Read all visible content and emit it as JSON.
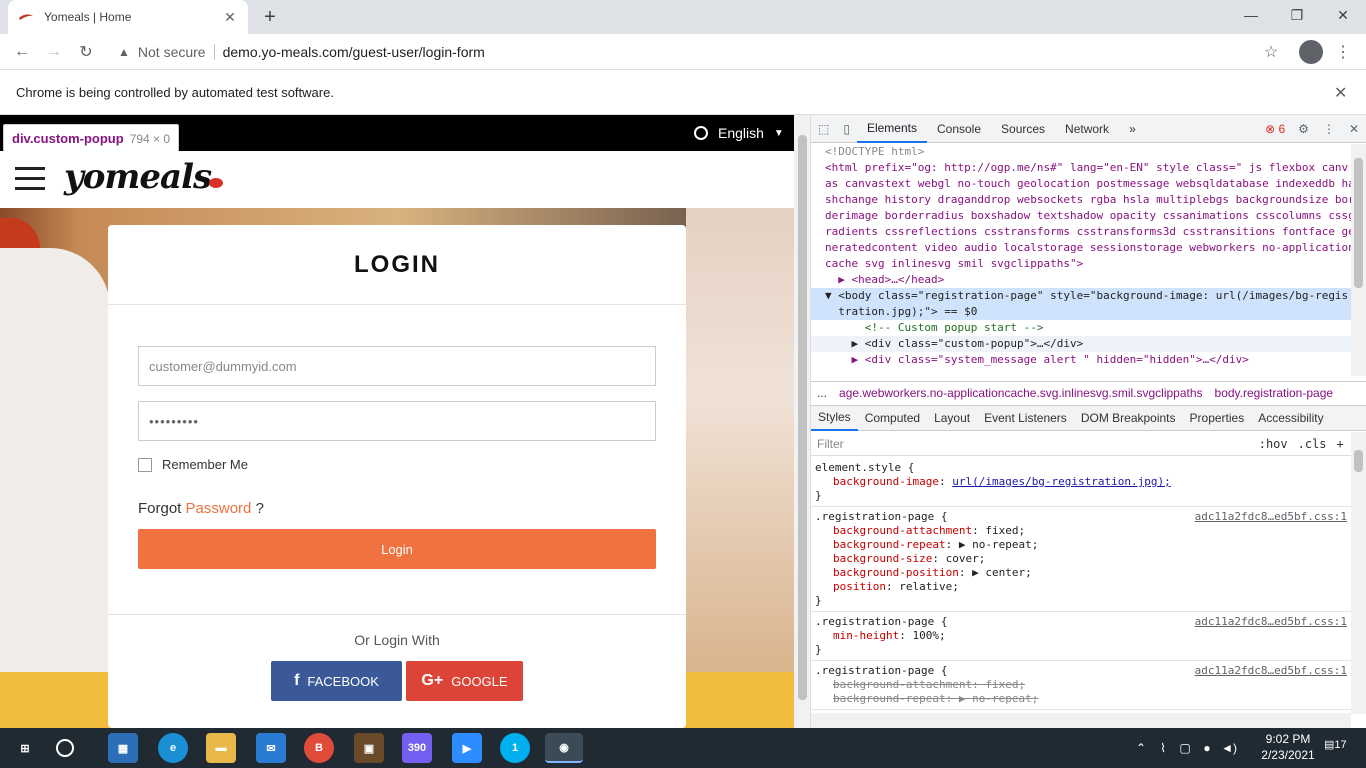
{
  "browser": {
    "tab_title": "Yomeals | Home",
    "new_tab_icon": "+",
    "address_security": "Not secure",
    "url": "demo.yo-meals.com/guest-user/login-form",
    "infobar_message": "Chrome is being controlled by automated test software."
  },
  "site": {
    "language": "English",
    "logo_text": "yomeals",
    "inspect_tooltip": {
      "selector": "div.custom-popup",
      "size": "794 × 0"
    },
    "login": {
      "heading": "LOGIN",
      "email_placeholder": "customer@dummyid.com",
      "password_value": "•••••••••",
      "remember_label": "Remember Me",
      "forgot_prefix": "Forgot",
      "forgot_link": "Password",
      "forgot_suffix": "?",
      "submit_label": "Login",
      "or_login_with": "Or Login With",
      "facebook_label": "FACEBOOK",
      "google_label": "GOOGLE"
    },
    "colors": {
      "accent": "#f07240",
      "facebook": "#3b5998",
      "google": "#db4437",
      "yellow_bar": "#f2bd3c"
    }
  },
  "devtools": {
    "tabs": [
      "Elements",
      "Console",
      "Sources",
      "Network"
    ],
    "more_tabs": "»",
    "error_count": "6",
    "elements_lines": [
      {
        "text": "<!DOCTYPE html>",
        "cls": "dim"
      },
      {
        "text": "<html prefix=\"og: http://ogp.me/ns#\" lang=\"en-EN\" style class=\" js flexbox canv",
        "cls": ""
      },
      {
        "text": "as canvastext webgl no-touch geolocation postmessage websqldatabase indexeddb ha",
        "cls": ""
      },
      {
        "text": "shchange history draganddrop websockets rgba hsla multiplebgs backgroundsize bor",
        "cls": ""
      },
      {
        "text": "derimage borderradius boxshadow textshadow opacity cssanimations csscolumns cssg",
        "cls": ""
      },
      {
        "text": "radients cssreflections csstransforms csstransforms3d csstransitions fontface ge",
        "cls": ""
      },
      {
        "text": "neratedcontent video audio localstorage sessionstorage webworkers no-application",
        "cls": ""
      },
      {
        "text": "cache svg inlinesvg smil svgclippaths\">",
        "cls": ""
      },
      {
        "text": "  ▶ <head>…</head>",
        "cls": ""
      },
      {
        "text": "▼ <body class=\"registration-page\" style=\"background-image: url(/images/bg-regis",
        "cls": "hl"
      },
      {
        "text": "  tration.jpg);\"> == $0",
        "cls": "hl"
      },
      {
        "text": "      <!-- Custom popup start -->",
        "cls": "cmt"
      },
      {
        "text": "    ▶ <div class=\"custom-popup\">…</div>",
        "cls": "hl2"
      },
      {
        "text": "    ▶ <div class=\"system_message alert \" hidden=\"hidden\">…</div>",
        "cls": ""
      }
    ],
    "breadcrumb_dots": "...",
    "breadcrumb_path": "age.webworkers.no-applicationcache.svg.inlinesvg.smil.svgclippaths",
    "breadcrumb_current": "body.registration-page",
    "subtabs": [
      "Styles",
      "Computed",
      "Layout",
      "Event Listeners",
      "DOM Breakpoints",
      "Properties",
      "Accessibility"
    ],
    "filter_placeholder": "Filter",
    "filter_hov": ":hov",
    "filter_cls": ".cls",
    "styles": {
      "r1_selector": "element.style {",
      "r1_p1_name": "background-image",
      "r1_p1_val": "url(/images/bg-registration.jpg);",
      "r2_selector": ".registration-page {",
      "r2_src": "adc11a2fdc8…ed5bf.css:1",
      "r2_p1": "background-attachment",
      "r2_v1": "fixed;",
      "r2_p2": "background-repeat",
      "r2_v2": "▶ no-repeat;",
      "r2_p3": "background-size",
      "r2_v3": "cover;",
      "r2_p4": "background-position",
      "r2_v4": "▶ center;",
      "r2_p5": "position",
      "r2_v5": "relative;",
      "r3_selector": ".registration-page {",
      "r3_src": "adc11a2fdc8…ed5bf.css:1",
      "r3_p1": "min-height",
      "r3_v1": "100%;",
      "r4_selector": ".registration-page {",
      "r4_src": "adc11a2fdc8…ed5bf.css:1",
      "r4_p1": "background-attachment",
      "r4_v1": "fixed;",
      "r4_p2": "background-repeat",
      "r4_v2": "▶ no-repeat;",
      "close_brace": "}"
    }
  },
  "taskbar": {
    "time": "9:02 PM",
    "date": "2/23/2021",
    "notification_count": "17",
    "badge_b": "B",
    "badge_viber": "390",
    "badge_skype": "1"
  }
}
